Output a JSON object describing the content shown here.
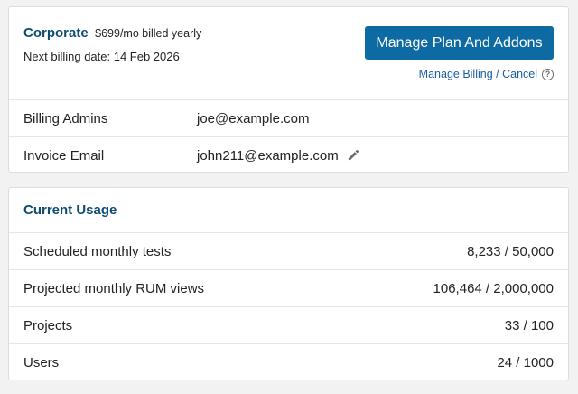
{
  "plan": {
    "name": "Corporate",
    "price": "$699/mo billed yearly",
    "next_billing": "Next billing date: 14 Feb 2026",
    "manage_button": "Manage Plan And Addons",
    "manage_billing_link": "Manage Billing / Cancel",
    "help_icon": "question-circle-icon"
  },
  "info_rows": [
    {
      "label": "Billing Admins",
      "value": "joe@example.com"
    },
    {
      "label": "Invoice Email",
      "value": "john211@example.com",
      "edit_icon": "pencil-icon"
    }
  ],
  "usage": {
    "title": "Current Usage",
    "rows": [
      {
        "label": "Scheduled monthly tests",
        "value": "8,233 / 50,000"
      },
      {
        "label": "Projected monthly RUM views",
        "value": "106,464 / 2,000,000"
      },
      {
        "label": "Projects",
        "value": "33 / 100"
      },
      {
        "label": "Users",
        "value": "24 / 1000"
      }
    ]
  },
  "colors": {
    "accent": "#0e6aa2",
    "heading": "#0e4d70",
    "link": "#1a5fa0",
    "background": "#f2f2f2"
  }
}
